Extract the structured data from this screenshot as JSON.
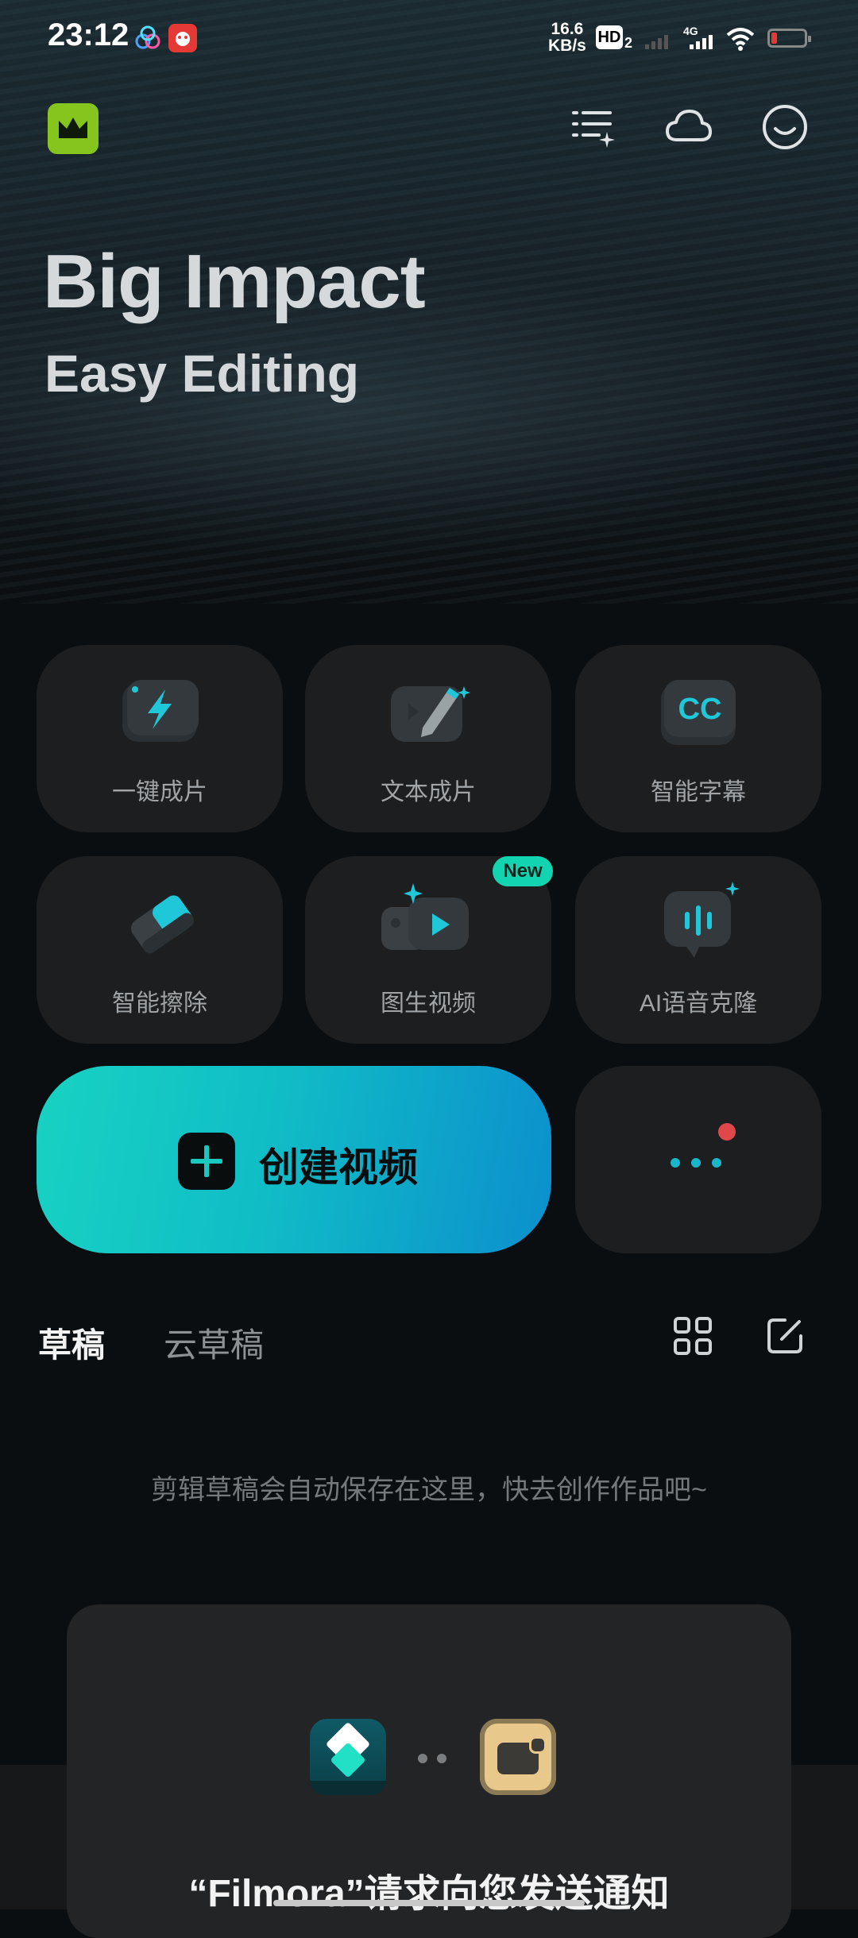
{
  "status_bar": {
    "time": "23:12",
    "net_speed_value": "16.6",
    "net_speed_unit": "KB/s",
    "hd_label": "HD",
    "hd_sub": "2",
    "network_type": "4G"
  },
  "header": {
    "brand_icon": "crown-icon",
    "icons": [
      "tasks-icon",
      "cloud-icon",
      "profile-icon"
    ]
  },
  "hero": {
    "title": "Big Impact",
    "subtitle": "Easy Editing"
  },
  "features": [
    {
      "label": "一键成片",
      "icon": "lightning-icon"
    },
    {
      "label": "文本成片",
      "icon": "pencil-video-icon"
    },
    {
      "label": "智能字幕",
      "icon": "cc-icon"
    },
    {
      "label": "智能擦除",
      "icon": "eraser-icon"
    },
    {
      "label": "图生视频",
      "icon": "image-to-video-icon",
      "badge": "New"
    },
    {
      "label": "AI语音克隆",
      "icon": "voice-wave-icon"
    }
  ],
  "create_button": {
    "label": "创建视频"
  },
  "tabs": [
    {
      "label": "草稿",
      "active": true
    },
    {
      "label": "云草稿",
      "active": false
    }
  ],
  "empty_message": "剪辑草稿会自动保存在这里，快去创作作品吧~",
  "dialog": {
    "title": "“Filmora”请求向您发送通知"
  },
  "colors": {
    "accent_start": "#18d2c2",
    "accent_end": "#0c8fcd",
    "badge": "#12d4b0",
    "notification_dot": "#e0474a",
    "brand_green": "#86c51e"
  }
}
